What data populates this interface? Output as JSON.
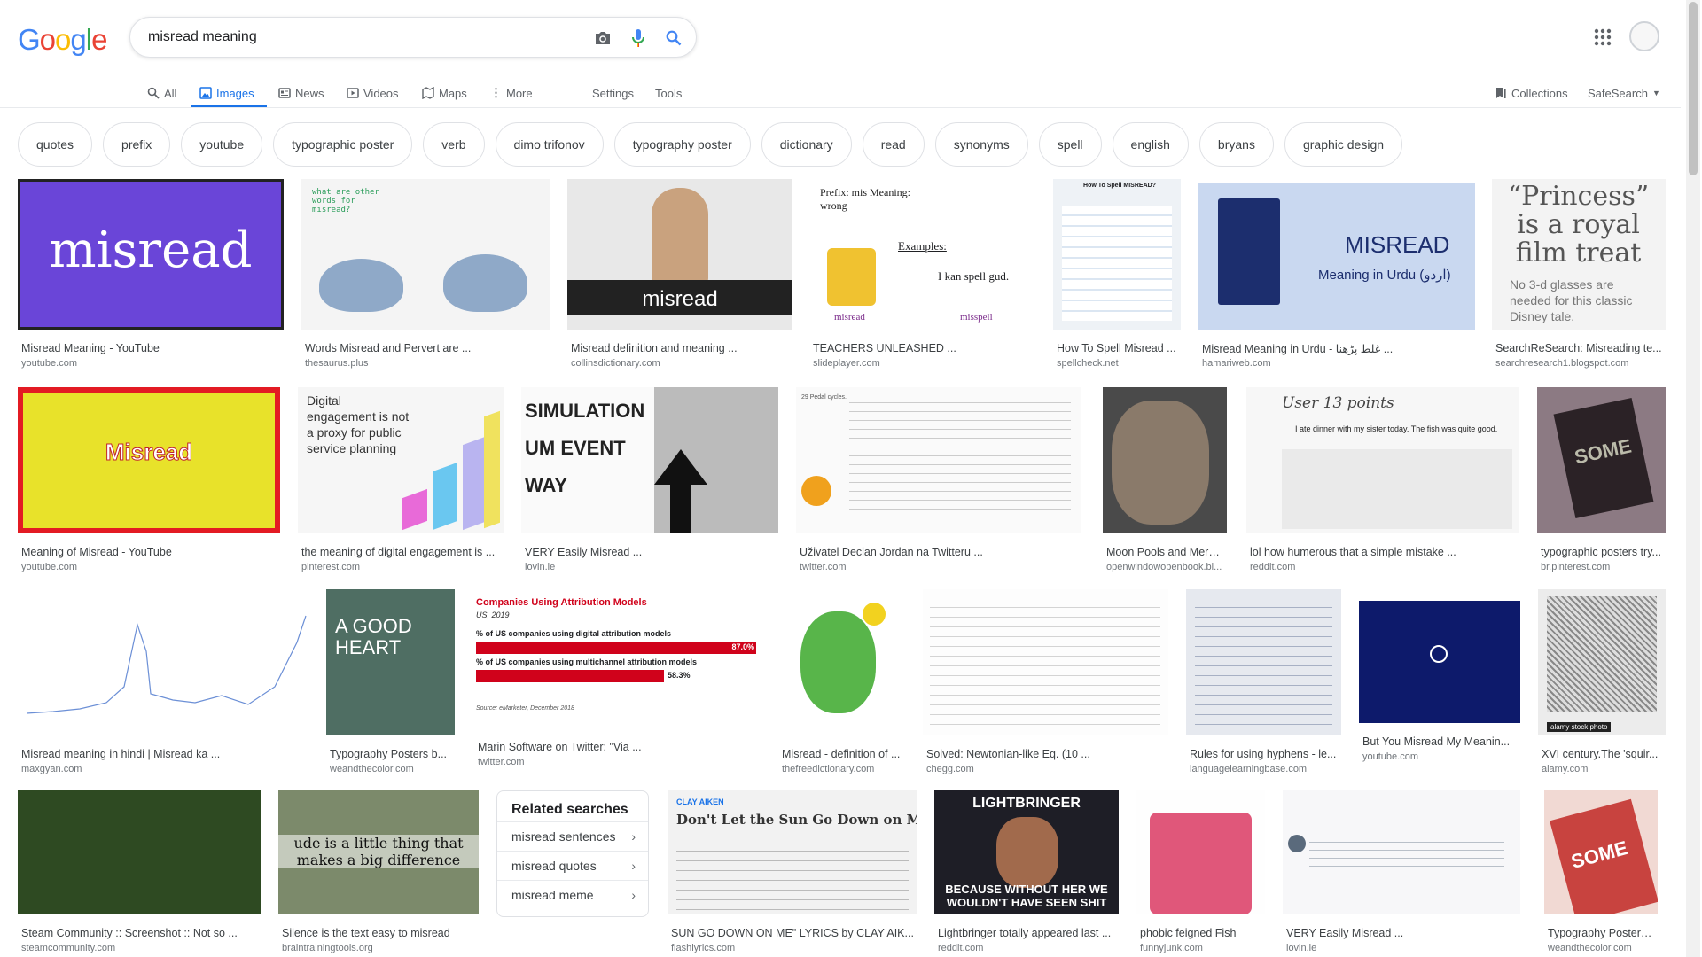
{
  "logo": {
    "text": "Google",
    "letters": [
      "G",
      "o",
      "o",
      "g",
      "l",
      "e"
    ],
    "colors": [
      "#4285F4",
      "#EA4335",
      "#FBBC05",
      "#4285F4",
      "#34A853",
      "#EA4335"
    ]
  },
  "search": {
    "query": "misread meaning"
  },
  "icons": {
    "camera": "camera-icon",
    "mic": "microphone-icon",
    "search": "search-icon",
    "apps": "apps-grid-icon"
  },
  "tabs": {
    "all": "All",
    "images": "Images",
    "news": "News",
    "videos": "Videos",
    "maps": "Maps",
    "more": "More",
    "settings": "Settings",
    "tools": "Tools",
    "collections": "Collections",
    "safesearch": "SafeSearch"
  },
  "chips": [
    "quotes",
    "prefix",
    "youtube",
    "typographic poster",
    "verb",
    "dimo trifonov",
    "typography poster",
    "dictionary",
    "read",
    "synonyms",
    "spell",
    "english",
    "bryans",
    "graphic design"
  ],
  "images": [
    {
      "title": "Misread Meaning - YouTube",
      "site": "youtube.com",
      "thumb_text": "misread"
    },
    {
      "title": "Words Misread and Pervert are ...",
      "site": "thesaurus.plus",
      "thumb_text": "what are other words for misread?"
    },
    {
      "title": "Misread definition and meaning ...",
      "site": "collinsdictionary.com",
      "thumb_text": "misread"
    },
    {
      "title": "TEACHERS UNLEASHED ...",
      "site": "slideplayer.com",
      "thumb_text": "Prefix: mis  Meaning: wrong"
    },
    {
      "title": "How To Spell Misread ...",
      "site": "spellcheck.net",
      "thumb_text": "How To Spell MISREAD?"
    },
    {
      "title": "Misread Meaning in Urdu - غلط پڑھنا ...",
      "site": "hamariweb.com",
      "thumb_text": "MISREAD"
    },
    {
      "title": "SearchReSearch: Misreading te...",
      "site": "searchresearch1.blogspot.com",
      "thumb_text": "“Princess” is a royal film treat"
    },
    {
      "title": "Meaning of Misread - YouTube",
      "site": "youtube.com",
      "thumb_text": "Misread"
    },
    {
      "title": "the meaning of digital engagement is ...",
      "site": "pinterest.com",
      "thumb_text": "Digital engagement is not a proxy for public service planning"
    },
    {
      "title": "VERY Easily Misread ...",
      "site": "lovin.ie",
      "thumb_text": "SIMULATION  UM EVENT  WAY"
    },
    {
      "title": "Uživatel Declan Jordan na Twitteru ...",
      "site": "twitter.com",
      "thumb_text": "29 Pedal cycles."
    },
    {
      "title": "Moon Pools and Merm...",
      "site": "openwindowopenbook.bl...",
      "thumb_text": ""
    },
    {
      "title": "lol how humerous that a simple mistake ...",
      "site": "reddit.com",
      "thumb_text": "User 13 points"
    },
    {
      "title": "typographic posters try...",
      "site": "br.pinterest.com",
      "thumb_text": "SOME"
    },
    {
      "title": "Misread meaning in hindi | Misread ka ...",
      "site": "maxgyan.com",
      "thumb_text": ""
    },
    {
      "title": "Typography Posters b...",
      "site": "weandthecolor.com",
      "thumb_text": "A GOOD HEART"
    },
    {
      "title": "Marin Software on Twitter: \"Via ...",
      "site": "twitter.com",
      "thumb_text": "Companies Using Attribution Models"
    },
    {
      "title": "Misread - definition of ...",
      "site": "thefreedictionary.com",
      "thumb_text": ""
    },
    {
      "title": "Solved: Newtonian-like Eq. (10 ...",
      "site": "chegg.com",
      "thumb_text": ""
    },
    {
      "title": "Rules for using hyphens - le...",
      "site": "languagelearningbase.com",
      "thumb_text": ""
    },
    {
      "title": "But You Misread My Meanin...",
      "site": "youtube.com",
      "thumb_text": ""
    },
    {
      "title": "XVI century.The 'squir...",
      "site": "alamy.com",
      "thumb_text": "alamy stock photo"
    },
    {
      "title": "Steam Community :: Screenshot :: Not so ...",
      "site": "steamcommunity.com",
      "thumb_text": ""
    },
    {
      "title": "Silence is the text easy to misread",
      "site": "braintrainingtools.org",
      "thumb_text": "ude is a little thing that makes a big difference"
    },
    {
      "title": "SUN GO DOWN ON ME\" LYRICS by CLAY AIK...",
      "site": "flashlyrics.com",
      "thumb_text": "Don't Let the Sun Go Down on Me Ly"
    },
    {
      "title": "Lightbringer totally appeared last ...",
      "site": "reddit.com",
      "thumb_text": "LIGHTBRINGER"
    },
    {
      "title": "phobic feigned Fish",
      "site": "funnyjunk.com",
      "thumb_text": ""
    },
    {
      "title": "VERY Easily Misread ...",
      "site": "lovin.ie",
      "thumb_text": ""
    },
    {
      "title": "Typography Posters b...",
      "site": "weandthecolor.com",
      "thumb_text": "SOME"
    }
  ],
  "chart_texts": {
    "attribution_sub": "US, 2019",
    "attribution_a": "% of US companies using digital attribution models",
    "attribution_a_val": "87.0%",
    "attribution_b": "% of US companies using multichannel attribution models",
    "attribution_b_val": "58.3%",
    "attribution_src": "Source: eMarketer, December 2018",
    "lightbringer_bottom": "BECAUSE WITHOUT HER WE WOULDN'T HAVE SEEN SHIT",
    "urdu_sub": "Meaning in Urdu (اردو)",
    "prefix_examples": "Examples:",
    "prefix_spell": "I kan spell gud.",
    "prefix_left": "misread",
    "prefix_right": "misspell",
    "princess_sub": "No 3-d glasses are needed for this classic Disney tale.",
    "clay_aiken": "CLAY AIKEN",
    "reddit_line": "I ate dinner with my sister today. The fish was quite good."
  },
  "related": {
    "title": "Related searches",
    "items": [
      "misread sentences",
      "misread quotes",
      "misread meme"
    ]
  }
}
